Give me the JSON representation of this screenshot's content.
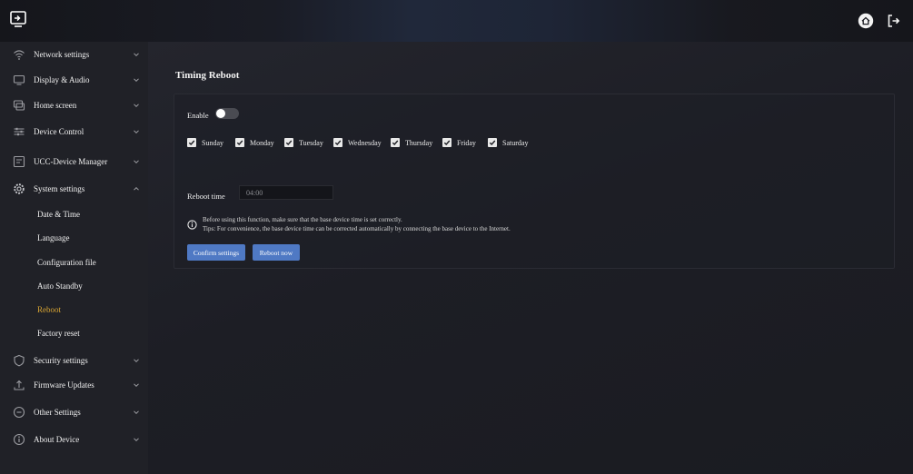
{
  "sidebar": {
    "items": [
      {
        "label": "Network settings",
        "icon": "wifi-icon"
      },
      {
        "label": "Display & Audio",
        "icon": "monitor-icon"
      },
      {
        "label": "Home screen",
        "icon": "home-screen-icon"
      },
      {
        "label": "Device Control",
        "icon": "sliders-icon"
      },
      {
        "label": "UCC-Device Manager",
        "icon": "device-manager-icon"
      },
      {
        "label": "System settings",
        "icon": "gear-icon",
        "expanded": true
      },
      {
        "label": "Security settings",
        "icon": "shield-icon"
      },
      {
        "label": "Firmware Updates",
        "icon": "upload-icon"
      },
      {
        "label": "Other Settings",
        "icon": "more-circle-icon"
      },
      {
        "label": "About Device",
        "icon": "info-circle-icon"
      }
    ],
    "sub_items": [
      {
        "label": "Date & Time"
      },
      {
        "label": "Language"
      },
      {
        "label": "Configuration file"
      },
      {
        "label": "Auto Standby"
      },
      {
        "label": "Reboot",
        "active": true
      },
      {
        "label": "Factory reset"
      }
    ]
  },
  "main": {
    "title": "Timing Reboot",
    "enable_label": "Enable",
    "enable_on": false,
    "days": [
      {
        "label": "Sunday",
        "checked": true
      },
      {
        "label": "Monday",
        "checked": true
      },
      {
        "label": "Tuesday",
        "checked": true
      },
      {
        "label": "Wednesday",
        "checked": true
      },
      {
        "label": "Thursday",
        "checked": true
      },
      {
        "label": "Friday",
        "checked": true
      },
      {
        "label": "Saturday",
        "checked": true
      }
    ],
    "reboot_time_label": "Reboot time",
    "reboot_time_value": "04:00",
    "info_line1": "Before using this function, make sure that the base device time is set correctly.",
    "info_line2": "Tips: For convenience, the base device time can be corrected automatically by connecting the base device to the Internet.",
    "confirm_button": "Confirm settings",
    "reboot_now_button": "Reboot now"
  },
  "colors": {
    "accent": "#d7a433",
    "button": "#4f79c4",
    "sidebar_bg": "#202127",
    "main_bg": "#1d1e25"
  }
}
